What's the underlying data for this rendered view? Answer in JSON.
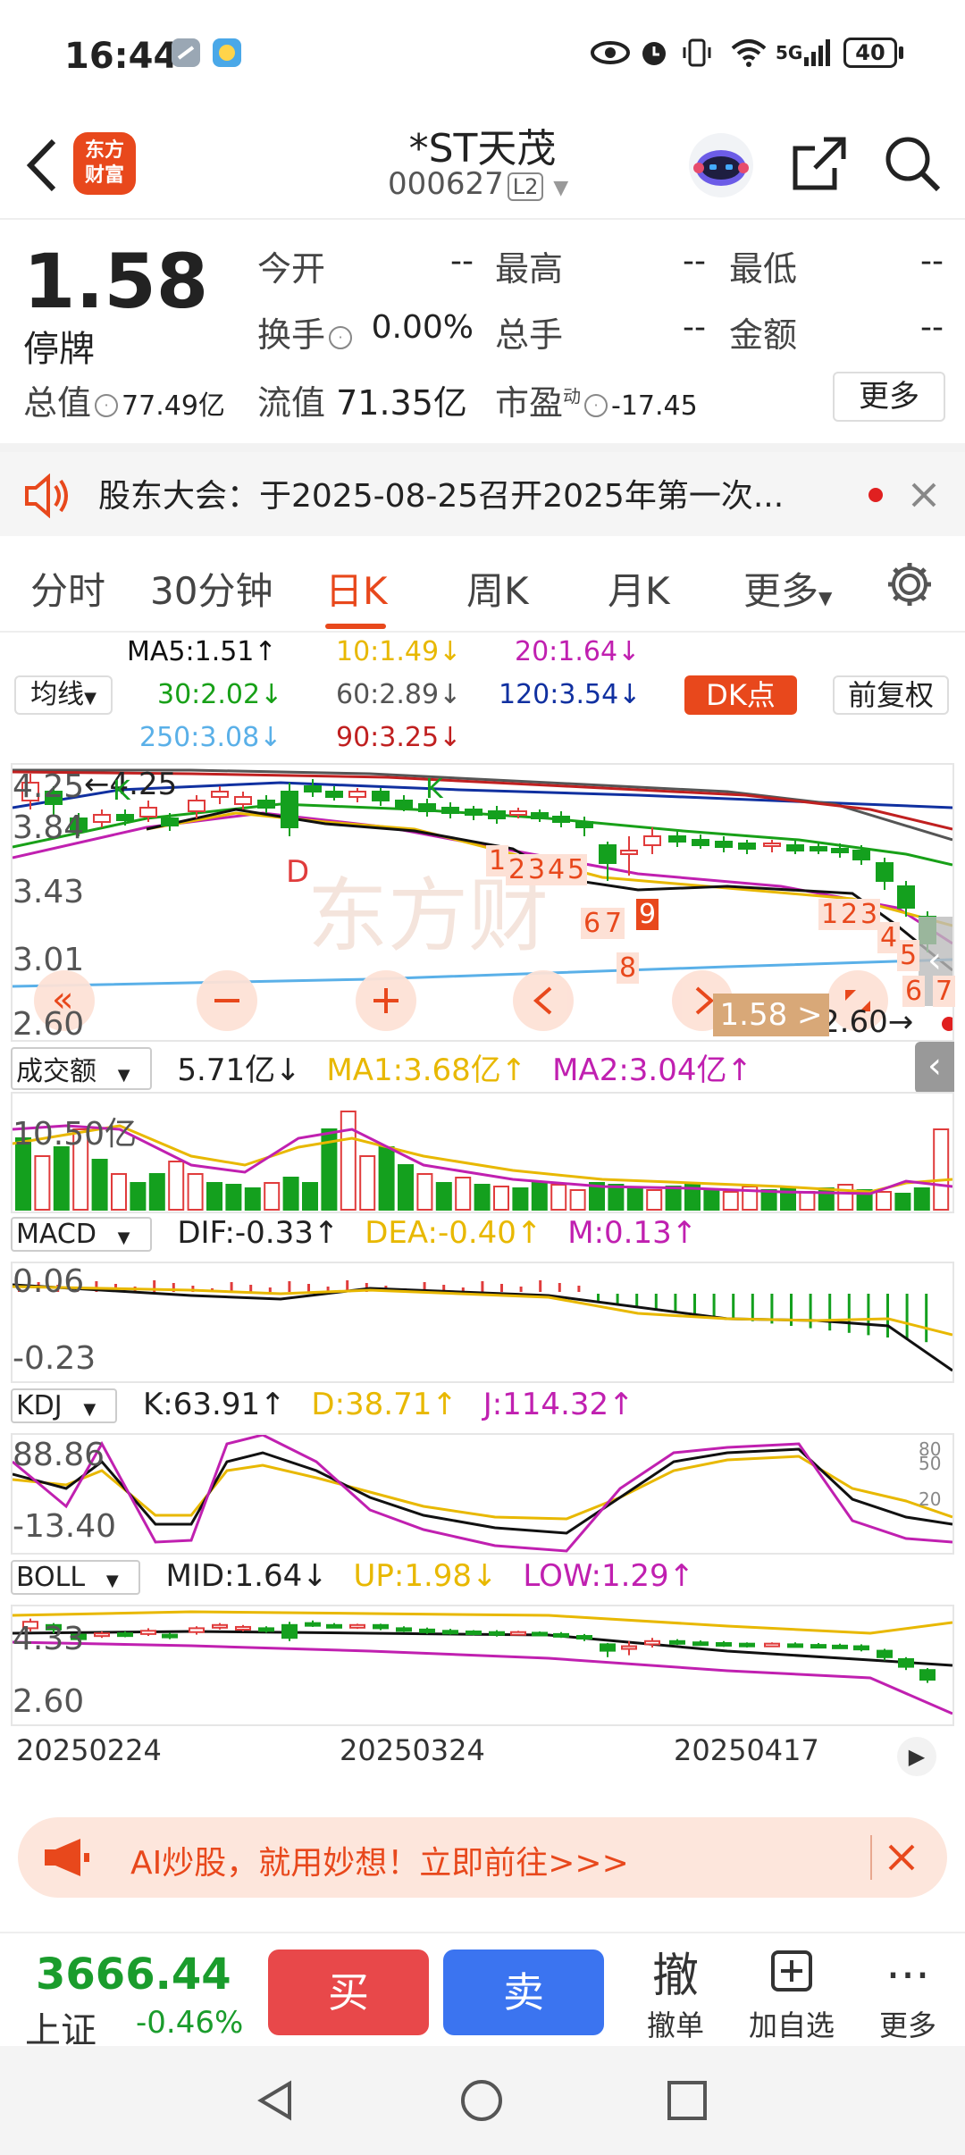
{
  "status_bar": {
    "time": "16:44",
    "network": "5G",
    "battery": "40"
  },
  "header": {
    "title": "*ST天茂",
    "code": "000627",
    "level": "L2",
    "logo_text": "东方财富"
  },
  "quote": {
    "price": "1.58",
    "state": "停牌",
    "open_label": "今开",
    "open_value": "--",
    "high_label": "最高",
    "high_value": "--",
    "low_label": "最低",
    "low_value": "--",
    "turnover_label": "换手",
    "turnover_value": "0.00%",
    "volume_label": "总手",
    "volume_value": "--",
    "amount_label": "金额",
    "amount_value": "--",
    "mktcap_label": "总值",
    "mktcap_value": "77.49亿",
    "float_label": "流值",
    "float_value": "71.35亿",
    "pe_label": "市盈",
    "pe_sup": "动",
    "pe_value": "-17.45",
    "more_label": "更多"
  },
  "announcement": {
    "text": "股东大会：于2025-08-25召开2025年第一次..."
  },
  "tabs": [
    {
      "label": "分时"
    },
    {
      "label": "30分钟"
    },
    {
      "label": "日K"
    },
    {
      "label": "周K"
    },
    {
      "label": "月K"
    },
    {
      "label": "更多"
    }
  ],
  "ma_legend": {
    "selector": "均线",
    "ma5": "MA5:1.51↑",
    "ma10": "10:1.49↓",
    "ma20": "20:1.64↓",
    "ma30": "30:2.02↓",
    "ma60": "60:2.89↓",
    "ma120": "120:3.54↓",
    "ma250": "250:3.08↓",
    "ma90": "90:3.25↓",
    "dk_label": "DK点",
    "fq_label": "前复权"
  },
  "colors": {
    "up": "#e03c3c",
    "down": "#14a01e",
    "accent": "#e8481c",
    "ma5": "#111111",
    "ma10": "#e8b800",
    "ma20": "#c020b0",
    "ma30": "#18a018",
    "ma60": "#555555",
    "ma120": "#1030a0",
    "ma250": "#5ab0e8",
    "ma90": "#c02020"
  },
  "kline": {
    "y_ticks": [
      "4.25",
      "3.84",
      "3.43",
      "3.01",
      "2.60"
    ],
    "max_label": "4.25",
    "min_label": "2.60",
    "price_tag": "1.58",
    "d_mark": "D",
    "k_mark": "K",
    "nine_marks": [
      "1",
      "2",
      "3",
      "4",
      "5",
      "6",
      "7",
      "8",
      "9"
    ]
  },
  "volume": {
    "selector": "成交额",
    "value": "5.71亿↓",
    "ma1": "MA1:3.68亿↑",
    "ma2": "MA2:3.04亿↑",
    "axis": "10.50亿"
  },
  "macd": {
    "selector": "MACD",
    "dif": "DIF:-0.33↑",
    "dea": "DEA:-0.40↑",
    "m": "M:0.13↑",
    "axis_top": "0.06",
    "axis_bottom": "-0.23"
  },
  "kdj": {
    "selector": "KDJ",
    "k": "K:63.91↑",
    "d": "D:38.71↑",
    "j": "J:114.32↑",
    "axis_top": "88.86",
    "axis_bottom": "-13.40",
    "r80": "80",
    "r50": "50",
    "r20": "20"
  },
  "boll": {
    "selector": "BOLL",
    "mid": "MID:1.64↓",
    "up": "UP:1.98↓",
    "low": "LOW:1.29↑",
    "axis_top": "4.33",
    "axis_bottom": "2.60"
  },
  "dates": [
    "20250224",
    "20250324",
    "20250417"
  ],
  "ad": {
    "text": "AI炒股，就用妙想！立即前往>>>"
  },
  "bottom": {
    "index_value": "3666.44",
    "index_name": "上证",
    "index_change": "-0.46%",
    "buy": "买",
    "sell": "卖",
    "cancel_icon": "撤",
    "cancel": "撤单",
    "add": "加自选",
    "more": "更多"
  }
}
